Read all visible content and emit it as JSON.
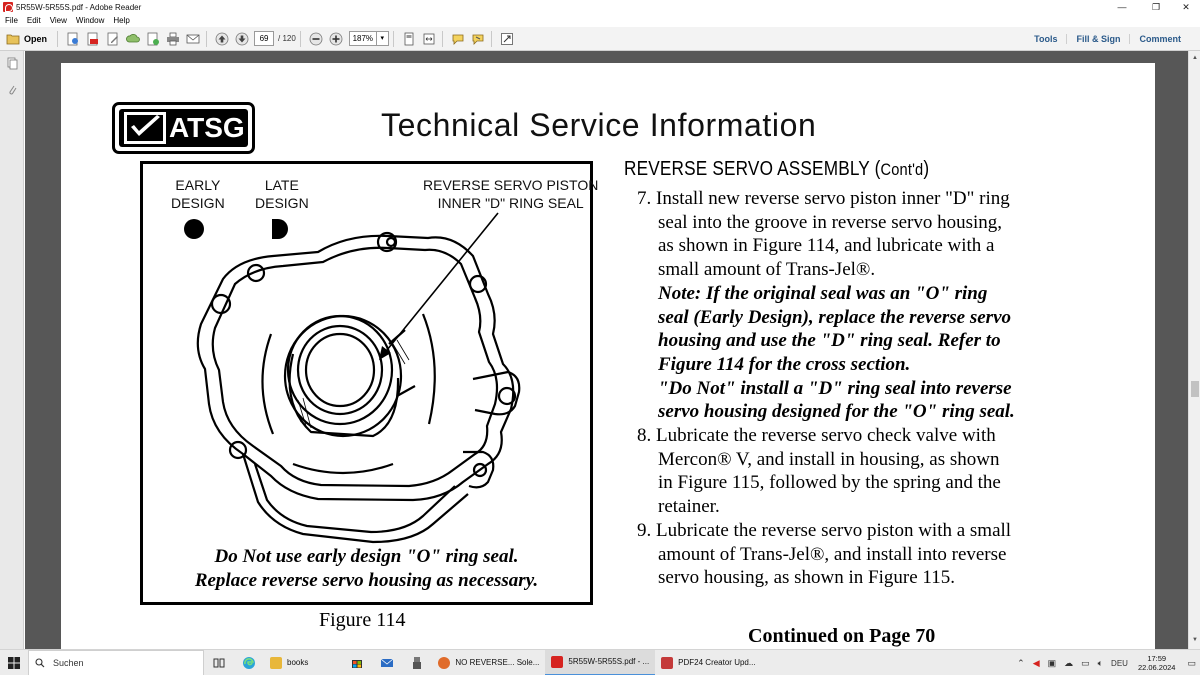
{
  "window": {
    "title": "5R55W-5R55S.pdf - Adobe Reader",
    "minimize": "—",
    "maximize": "❐",
    "close": "✕"
  },
  "menu": [
    "File",
    "Edit",
    "View",
    "Window",
    "Help"
  ],
  "toolbar": {
    "open_label": "Open",
    "page_current": "69",
    "page_total": "/ 120",
    "zoom": "187%",
    "tools_label": "Tools",
    "fill_sign_label": "Fill & Sign",
    "comment_label": "Comment"
  },
  "document": {
    "logo_text": "ATSG",
    "title": "Technical Service Information",
    "figure": {
      "early_design": [
        "EARLY",
        "DESIGN"
      ],
      "late_design": [
        "LATE",
        "DESIGN"
      ],
      "callout": [
        "REVERSE SERVO PISTON",
        "INNER \"D\" RING SEAL"
      ],
      "caption": [
        "Do Not use early design \"O\" ring seal.",
        "Replace reverse servo housing as necessary."
      ],
      "label": "Figure 114"
    },
    "section_heading_main": "REVERSE SERVO ASSEMBLY (",
    "section_heading_sub": "Cont'd",
    "section_heading_end": ")",
    "lines": [
      {
        "text": "7. Install new reverse servo piston inner \"D\" ring",
        "style": "plain",
        "indent": false
      },
      {
        "text": "seal into the groove in reverse servo housing,",
        "style": "plain",
        "indent": true
      },
      {
        "text": "as shown in Figure 114, and lubricate with a",
        "style": "plain",
        "indent": true
      },
      {
        "text": "small amount of Trans-Jel®.",
        "style": "plain",
        "indent": true
      },
      {
        "text": "Note: If the original seal was an \"O\" ring",
        "style": "note",
        "indent": true
      },
      {
        "text": "seal (Early Design), replace the reverse servo",
        "style": "note",
        "indent": true
      },
      {
        "text": "housing and use the \"D\" ring seal.  Refer to",
        "style": "note",
        "indent": true
      },
      {
        "text": "Figure 114 for the cross section.",
        "style": "note",
        "indent": true
      },
      {
        "text": "\"Do Not\" install a \"D\" ring seal into reverse",
        "style": "note",
        "indent": true
      },
      {
        "text": "servo housing designed for the \"O\" ring seal.",
        "style": "note",
        "indent": true
      },
      {
        "text": "8. Lubricate the reverse servo check valve with",
        "style": "plain",
        "indent": false
      },
      {
        "text": "Mercon® V, and install in housing, as shown",
        "style": "plain",
        "indent": true
      },
      {
        "text": "in Figure 115, followed by the spring and the",
        "style": "plain",
        "indent": true
      },
      {
        "text": "retainer.",
        "style": "plain",
        "indent": true
      },
      {
        "text": "9. Lubricate the reverse servo piston with a small",
        "style": "plain",
        "indent": false
      },
      {
        "text": "amount of Trans-Jel®, and install into reverse",
        "style": "plain",
        "indent": true
      },
      {
        "text": "servo housing, as shown in Figure 115.",
        "style": "plain",
        "indent": true
      }
    ],
    "continued": "Continued on Page 70"
  },
  "taskbar": {
    "search_placeholder": "Suchen",
    "apps": [
      {
        "label": "books",
        "color": "#e8b73a",
        "active": false
      },
      {
        "label": "NO REVERSE... Sole...",
        "color": "#e06b2a",
        "active": false
      },
      {
        "label": "5R55W-5R55S.pdf - ...",
        "color": "#d6231f",
        "active": true
      },
      {
        "label": "PDF24 Creator Upd...",
        "color": "#c43a3a",
        "active": false
      }
    ],
    "lang": "DEU",
    "time": "17:59",
    "date": "22.06.2024"
  },
  "colors": {
    "doc_background": "#575757",
    "toolbar_links": "#2b5a8a",
    "taskbar_active_accent": "#4a90d9"
  }
}
